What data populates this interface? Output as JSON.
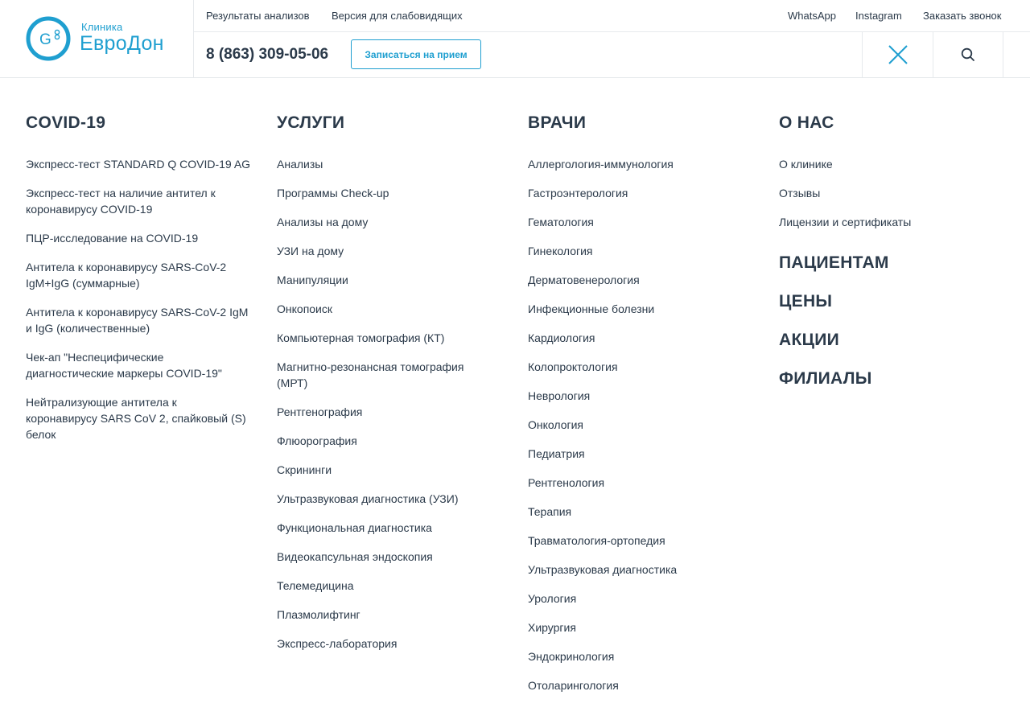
{
  "header": {
    "logo": {
      "small": "Клиника",
      "big": "ЕвроДон",
      "mark": "G"
    },
    "top_links": {
      "results": "Результаты анализов",
      "low_vision": "Версия для слабовидящих",
      "whatsapp": "WhatsApp",
      "instagram": "Instagram",
      "callback": "Заказать звонок"
    },
    "phone": "8 (863) 309-05-06",
    "book_button": "Записаться на прием"
  },
  "colors": {
    "accent": "#1f9fd0",
    "text": "#2b3a4a",
    "border": "#e6e9ec"
  },
  "icons": {
    "close": "close-icon",
    "search": "search-icon"
  },
  "menu": {
    "covid": {
      "title": "COVID-19",
      "items": [
        "Экспресс-тест STANDARD Q COVID-19 AG",
        "Экспресс-тест на наличие антител к коронавирусу COVID-19",
        "ПЦР-исследование на COVID-19",
        "Антитела к коронавирусу SARS-CoV-2 IgM+IgG (суммарные)",
        "Антитела к коронавирусу SARS-CoV-2 IgM и IgG (количественные)",
        "Чек-ап \"Неспецифические диагностические маркеры COVID-19\"",
        "Нейтрализующие антитела к коронавирусу SARS CoV 2, спайковый (S) белок"
      ]
    },
    "services": {
      "title": "УСЛУГИ",
      "items": [
        "Анализы",
        "Программы Check-up",
        "Анализы на дому",
        "УЗИ на дому",
        "Манипуляции",
        "Онкопоиск",
        "Компьютерная томография (КТ)",
        "Магнитно-резонансная томография (МРТ)",
        "Рентгенография",
        "Флюорография",
        "Скрининги",
        "Ультразвуковая диагностика (УЗИ)",
        "Функциональная диагностика",
        "Видеокапсульная эндоскопия",
        "Телемедицина",
        "Плазмолифтинг",
        "Экспресс-лаборатория"
      ]
    },
    "doctors": {
      "title": "ВРАЧИ",
      "items": [
        "Аллергология-иммунология",
        "Гастроэнтерология",
        "Гематология",
        "Гинекология",
        "Дерматовенерология",
        "Инфекционные болезни",
        "Кардиология",
        "Колопроктология",
        "Неврология",
        "Онкология",
        "Педиатрия",
        "Рентгенология",
        "Терапия",
        "Травматология-ортопедия",
        "Ультразвуковая диагностика",
        "Урология",
        "Хирургия",
        "Эндокринология",
        "Отоларингология"
      ]
    },
    "about": {
      "title": "О НАС",
      "items": [
        "О клинике",
        "Отзывы",
        "Лицензии и сертификаты"
      ]
    },
    "extra_sections": [
      "ПАЦИЕНТАМ",
      "ЦЕНЫ",
      "АКЦИИ",
      "ФИЛИАЛЫ"
    ]
  }
}
